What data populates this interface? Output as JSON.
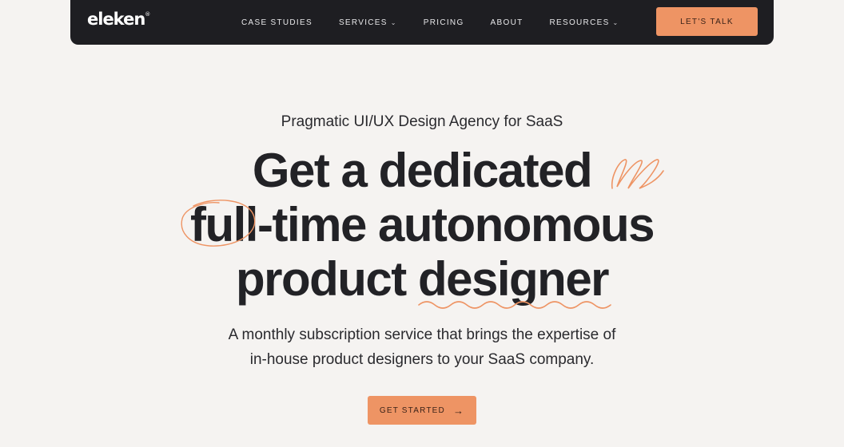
{
  "nav": {
    "logo": "eleken",
    "logo_mark": "®",
    "links": [
      {
        "label": "CASE STUDIES",
        "has_dropdown": false
      },
      {
        "label": "SERVICES",
        "has_dropdown": true
      },
      {
        "label": "PRICING",
        "has_dropdown": false
      },
      {
        "label": "ABOUT",
        "has_dropdown": false
      },
      {
        "label": "RESOURCES",
        "has_dropdown": true
      }
    ],
    "cta_label": "LET'S TALK"
  },
  "hero": {
    "eyebrow": "Pragmatic UI/UX Design Agency for SaaS",
    "headline": {
      "line1": "Get a dedicated",
      "line2_circled": "full",
      "line2_rest": "-time autonomous",
      "line3_plain": "product ",
      "line3_underlined": "designer"
    },
    "subtitle_line1": "A monthly subscription service that brings the expertise of",
    "subtitle_line2": "in-house product designers to your SaaS company.",
    "cta_label": "GET STARTED",
    "cta_arrow": "→"
  },
  "colors": {
    "background": "#f5f3f1",
    "nav_background": "#1e1e22",
    "accent": "#ee9464",
    "text": "#222226"
  },
  "icons": {
    "dropdown": "chevron-down-icon",
    "cta_arrow": "arrow-right-icon"
  }
}
